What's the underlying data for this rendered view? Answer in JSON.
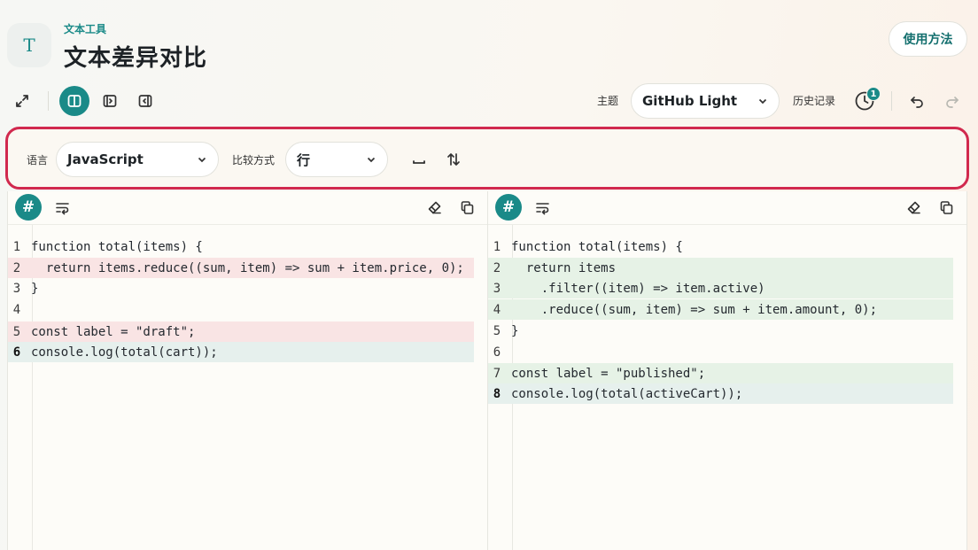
{
  "header": {
    "kicker": "文本工具",
    "title": "文本差异对比",
    "help_label": "使用方法",
    "logo_glyph": "T"
  },
  "toolbar": {
    "theme_label": "主题",
    "theme_value": "GitHub Light",
    "history_label": "历史记录",
    "history_count": "1",
    "icons": [
      "expand-icon",
      "split-view-icon",
      "right-panel-icon",
      "left-panel-icon",
      "history-icon",
      "undo-icon",
      "redo-icon"
    ]
  },
  "options": {
    "language_label": "语言",
    "language_value": "JavaScript",
    "compare_label": "比较方式",
    "compare_value": "行"
  },
  "left_pane": {
    "lines": [
      {
        "num": "1",
        "text": "function total(items) {",
        "state": "normal"
      },
      {
        "num": "2",
        "text": "  return items.reduce((sum, item) => sum + item.price, 0);",
        "state": "deleted"
      },
      {
        "num": "3",
        "text": "}",
        "state": "normal"
      },
      {
        "num": "4",
        "text": "",
        "state": "normal"
      },
      {
        "num": "5",
        "text": "const label = \"draft\";",
        "state": "deleted"
      },
      {
        "num": "6",
        "text": "console.log(total(cart));",
        "state": "current"
      }
    ]
  },
  "right_pane": {
    "lines": [
      {
        "num": "1",
        "text": "function total(items) {",
        "state": "normal"
      },
      {
        "num": "2",
        "text": "  return items",
        "state": "added"
      },
      {
        "num": "3",
        "text": "    .filter((item) => item.active)",
        "state": "added"
      },
      {
        "num": "4",
        "text": "    .reduce((sum, item) => sum + item.amount, 0);",
        "state": "added"
      },
      {
        "num": "5",
        "text": "}",
        "state": "normal"
      },
      {
        "num": "6",
        "text": "",
        "state": "normal"
      },
      {
        "num": "7",
        "text": "const label = \"published\";",
        "state": "added"
      },
      {
        "num": "8",
        "text": "console.log(total(activeCart));",
        "state": "current"
      }
    ]
  },
  "colors": {
    "accent": "#1a8a88",
    "highlight_border": "#d1294e",
    "deleted_bg": "#f9e4e4",
    "added_bg": "#e6f2e6"
  }
}
